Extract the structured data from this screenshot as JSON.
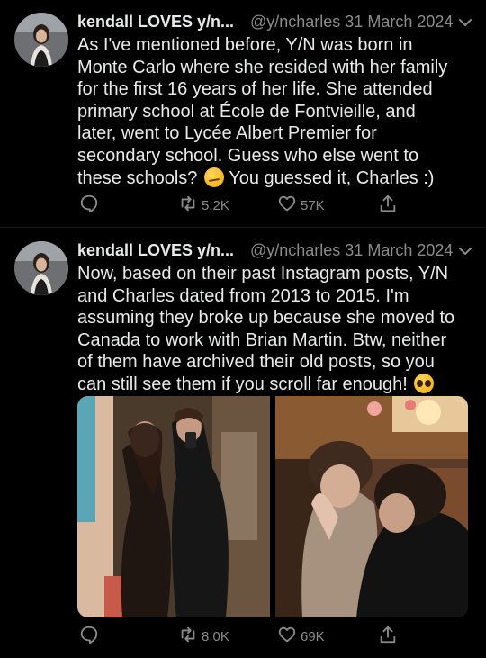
{
  "tweets": [
    {
      "display_name": "kendall LOVES y/n...",
      "handle_date": "@y/ncharles 31 March 2024",
      "text": "As I've mentioned before, Y/N was born in\nMonte Carlo where she resided with her family\nfor the first 16 years of her life. She attended\nprimary school at École de Fontvieille, and\nlater, went to Lycée Albert Premier for\nsecondary school. Guess who else went to\nthese schools?",
      "text_tail": "You guessed it, Charles :)",
      "emoji": "smirking-face",
      "retweets": "5.2K",
      "likes": "57K"
    },
    {
      "display_name": "kendall LOVES y/n...",
      "handle_date": "@y/ncharles 31 March 2024",
      "text": "Now, based on their past Instagram posts, Y/N\nand Charles dated from 2013 to 2015. I'm\nassuming they broke up because she moved to\nCanada to work with Brian Martin. Btw, neither\nof them have archived their old posts, so you\ncan still see them if you scroll far enough!",
      "emoji": "pleading-face",
      "retweets": "8.0K",
      "likes": "69K"
    }
  ],
  "icons": {
    "reply": "reply-icon",
    "retweet": "retweet-icon",
    "like": "heart-icon",
    "share": "share-icon",
    "more": "chevron-down-icon"
  },
  "colors": {
    "background": "#000000",
    "text": "#e7e9ea",
    "secondary": "#8b8b8b"
  }
}
